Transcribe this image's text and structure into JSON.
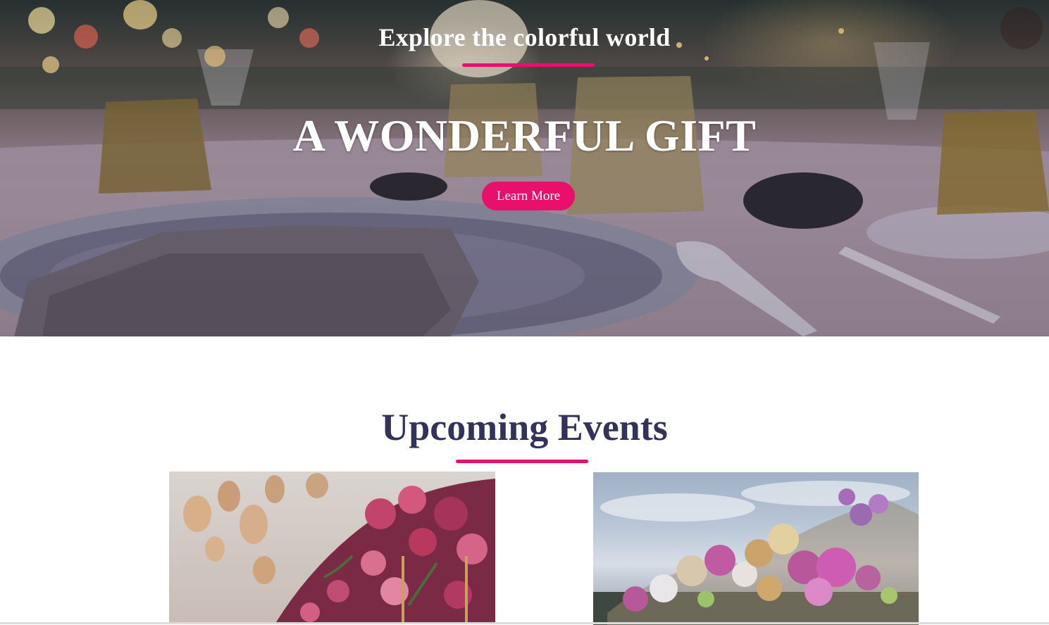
{
  "hero": {
    "subtitle": "Explore the colorful world",
    "title": "A WONDERFUL GIFT",
    "cta_label": "Learn More"
  },
  "events": {
    "heading": "Upcoming Events"
  },
  "colors": {
    "accent": "#e8106b",
    "heading": "#33335a"
  }
}
